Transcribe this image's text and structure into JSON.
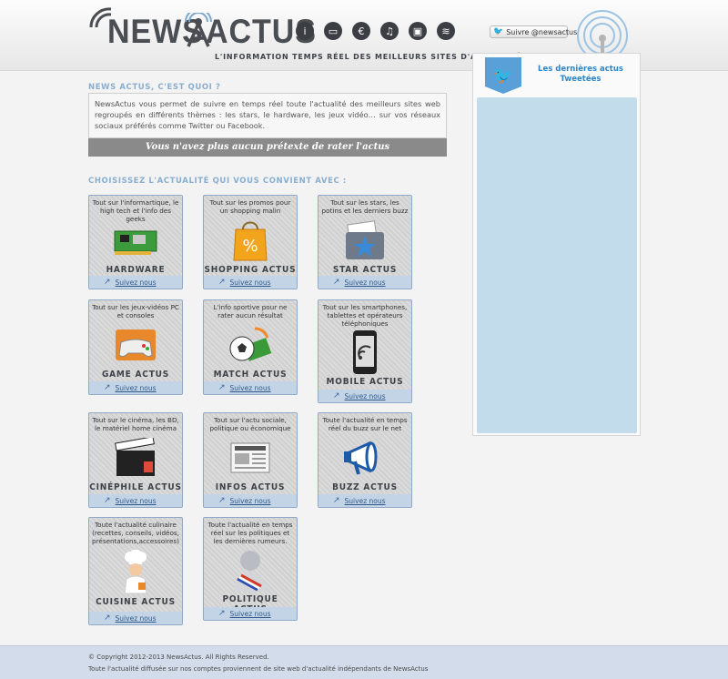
{
  "header": {
    "logo_news": "NEWS",
    "logo_actus": "ACTUS",
    "tagline": "L'INFORMATION TEMPS RÉEL DES MEILLEURS SITES D'ACTUALITÉS.",
    "social_icons": [
      "info-icon",
      "monitor-icon",
      "euro-icon",
      "music-icon",
      "tv-icon",
      "rss-icon"
    ],
    "social_glyphs": [
      "i",
      "▭",
      "€",
      "♫",
      "▣",
      "≋"
    ],
    "follow_label": "Suivre @newsactus"
  },
  "intro": {
    "title": "NEWS ACTUS, C'EST QUOI ?",
    "text": "NewsActus vous permet de suivre en temps réel toute l'actualité des meilleurs sites web regroupés en différents thèmes : les stars, le hardware, les jeux vidéo… sur vos réseaux sociaux préférés comme Twitter ou Facebook.",
    "banner": "Vous n'avez plus aucun prétexte de rater l'actus"
  },
  "choose_title": "CHOISISSEZ L'ACTUALITÉ QUI VOUS CONVIENT AVEC :",
  "follow_link_label": "Suivez nous",
  "cards": [
    {
      "desc": "Tout sur l'informartique, le high tech et l'info des geeks",
      "title": "HARDWARE ACTUS",
      "icon": "circuit-board-icon"
    },
    {
      "desc": "Tout sur les promos pour un shopping malin",
      "title": "SHOPPING ACTUS",
      "icon": "shopping-bag-icon"
    },
    {
      "desc": "Tout sur les stars, les potins et les derniers buzz",
      "title": "STAR ACTUS",
      "icon": "star-folder-icon"
    },
    {
      "desc": "Tout sur les jeux-vidéos PC et consoles",
      "title": "GAME ACTUS",
      "icon": "gamepad-icon"
    },
    {
      "desc": "L'info sportive pour ne rater aucun résultat",
      "title": "MATCH ACTUS",
      "icon": "football-icon"
    },
    {
      "desc": "Tout sur les smartphones, tablettes et opérateurs téléphoniques",
      "title": "MOBILE ACTUS",
      "icon": "smartphone-icon"
    },
    {
      "desc": "Tout sur le cinéma, les BD, le matériel home cinéma",
      "title": "CINÉPHILE ACTUS",
      "icon": "clapperboard-icon"
    },
    {
      "desc": "Tout sur l'actu sociale, politique ou économique",
      "title": "INFOS ACTUS",
      "icon": "newspaper-icon"
    },
    {
      "desc": "Toute l'actualité en temps réel du buzz sur le net",
      "title": "BUZZ ACTUS",
      "icon": "megaphone-icon"
    },
    {
      "desc": "Toute l'actualité culinaire (recettes, conseils, vidéos, présentations,accessoires)",
      "title": "CUISINE ACTUS",
      "icon": "chef-icon"
    },
    {
      "desc": "Toute l'actualité en temps réel sur les politiques et les dernières rumeurs.",
      "title": "POLITIQUE ACTUS",
      "icon": "politician-icon"
    }
  ],
  "twitter": {
    "heading": "Les dernières actus Tweetées"
  },
  "footer": {
    "copyright": "© Copyright 2012-2013 NewsActus. All Rights Reserved.",
    "note": "Toute l'actualité diffusée sur nos comptes proviennent de site web d'actualité indépendants de NewsActus"
  },
  "colors": {
    "accent_blue": "#8aaecf",
    "card_footer": "#c3d4e6",
    "twitter_blue": "#2d85c8",
    "banner_grey": "#8a8a8a"
  }
}
